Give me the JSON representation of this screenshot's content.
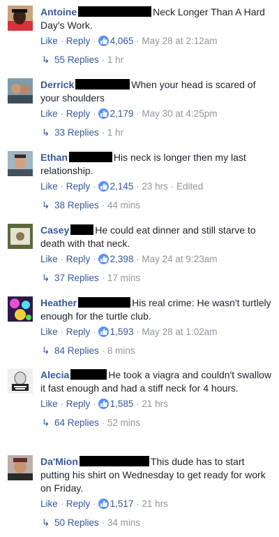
{
  "ui": {
    "like": "Like",
    "reply": "Reply",
    "sep": "·"
  },
  "comments": [
    {
      "name": "Antoine",
      "redact_w": 105,
      "text": "Neck Longer Than A Hard Day's Work.",
      "likes": "4,065",
      "time": "May 28 at 2:12am",
      "edited": "",
      "replies": "55 Replies",
      "reply_time": "1 hr"
    },
    {
      "name": "Derrick",
      "redact_w": 78,
      "text": "When your head is scared of your shoulders",
      "likes": "2,179",
      "time": "May 30 at 4:25pm",
      "edited": "",
      "replies": "33 Replies",
      "reply_time": "1 hr"
    },
    {
      "name": "Ethan",
      "redact_w": 62,
      "text": "His neck is longer then my last relationship.",
      "likes": "2,145",
      "time": "23 hrs",
      "edited": "Edited",
      "replies": "38 Replies",
      "reply_time": "44 mins"
    },
    {
      "name": "Casey",
      "redact_w": 33,
      "text": "He could eat dinner and still starve to death with that neck.",
      "likes": "2,398",
      "time": "May 24 at 9:23am",
      "edited": "",
      "replies": "37 Replies",
      "reply_time": "17 mins"
    },
    {
      "name": "Heather",
      "redact_w": 75,
      "text": "His real crime: He wasn't turtlely enough for the turtle club.",
      "likes": "1,593",
      "time": "May 28 at 1:02am",
      "edited": "",
      "replies": "84 Replies",
      "reply_time": "8 mins"
    },
    {
      "name": "Alecia",
      "redact_w": 52,
      "text": "He took a viagra and couldn't swallow it fast enough and had a stiff neck for 4 hours.",
      "likes": "1,585",
      "time": "21 hrs",
      "edited": "",
      "replies": "64 Replies",
      "reply_time": "52 mins"
    },
    {
      "name": "Da'Mion",
      "redact_w": 100,
      "text": "This dude has to start putting his shirt on Wednesday to get ready for work on Friday.",
      "likes": "1,517",
      "time": "21 hrs",
      "edited": "",
      "replies": "50 Replies",
      "reply_time": "34 mins"
    }
  ]
}
